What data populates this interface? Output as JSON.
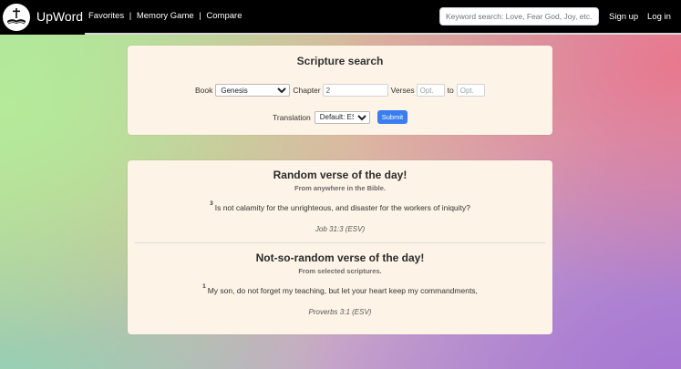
{
  "app": {
    "brand": "UpWord"
  },
  "nav": {
    "links": [
      "Favorites",
      "Memory Game",
      "Compare"
    ],
    "separator": "|",
    "search_placeholder": "Keyword search: Love, Fear God, Joy, etc.",
    "signup": "Sign up",
    "login": "Log in"
  },
  "scripture_search": {
    "title": "Scripture search",
    "book_label": "Book",
    "book_value": "Genesis",
    "chapter_label": "Chapter",
    "chapter_value": "2",
    "verses_label": "Verses",
    "verse_from_placeholder": "Opt.",
    "to_label": "to",
    "verse_to_placeholder": "Opt.",
    "translation_label": "Translation",
    "translation_value": "Default: ESV",
    "submit_label": "Submit"
  },
  "random_verse": {
    "title": "Random verse of the day!",
    "subtitle": "From anywhere in the Bible.",
    "verse_number": "3",
    "text": "Is not calamity for the unrighteous, and disaster for the workers of iniquity?",
    "reference": "Job 31:3 (ESV)"
  },
  "selected_verse": {
    "title": "Not-so-random verse of the day!",
    "subtitle": "From selected scriptures.",
    "verse_number": "1",
    "text": "My son, do not forget my teaching, but let your heart keep my commandments,",
    "reference": "Proverbs 3:1 (ESV)"
  },
  "colors": {
    "navbar": "#000000",
    "card": "#fdf3e6",
    "submit": "#3a7df0"
  }
}
